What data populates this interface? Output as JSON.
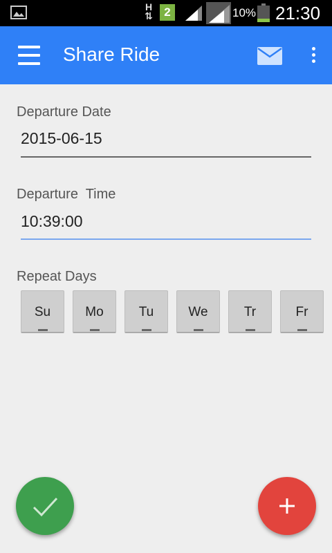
{
  "status_bar": {
    "network_type_top": "H",
    "network_type_bottom": "⇅",
    "sim_slot": "2",
    "battery_percent": "10%",
    "time": "21:30"
  },
  "app_bar": {
    "title": "Share Ride",
    "menu_icon": "hamburger-menu-icon",
    "mail_icon": "mail-icon",
    "overflow_icon": "more-vert-icon",
    "color": "#2f80f7"
  },
  "form": {
    "departure_date": {
      "label": "Departure Date",
      "value": "2015-06-15"
    },
    "departure_time": {
      "label": "Departure  Time",
      "value": "10:39:00"
    },
    "repeat_days": {
      "label": "Repeat Days",
      "days": [
        "Su",
        "Mo",
        "Tu",
        "We",
        "Tr",
        "Fr"
      ]
    }
  },
  "fabs": {
    "confirm": {
      "icon": "check-icon",
      "color": "#3e9f4e"
    },
    "add": {
      "icon": "plus-icon",
      "color": "#e2443d"
    }
  }
}
